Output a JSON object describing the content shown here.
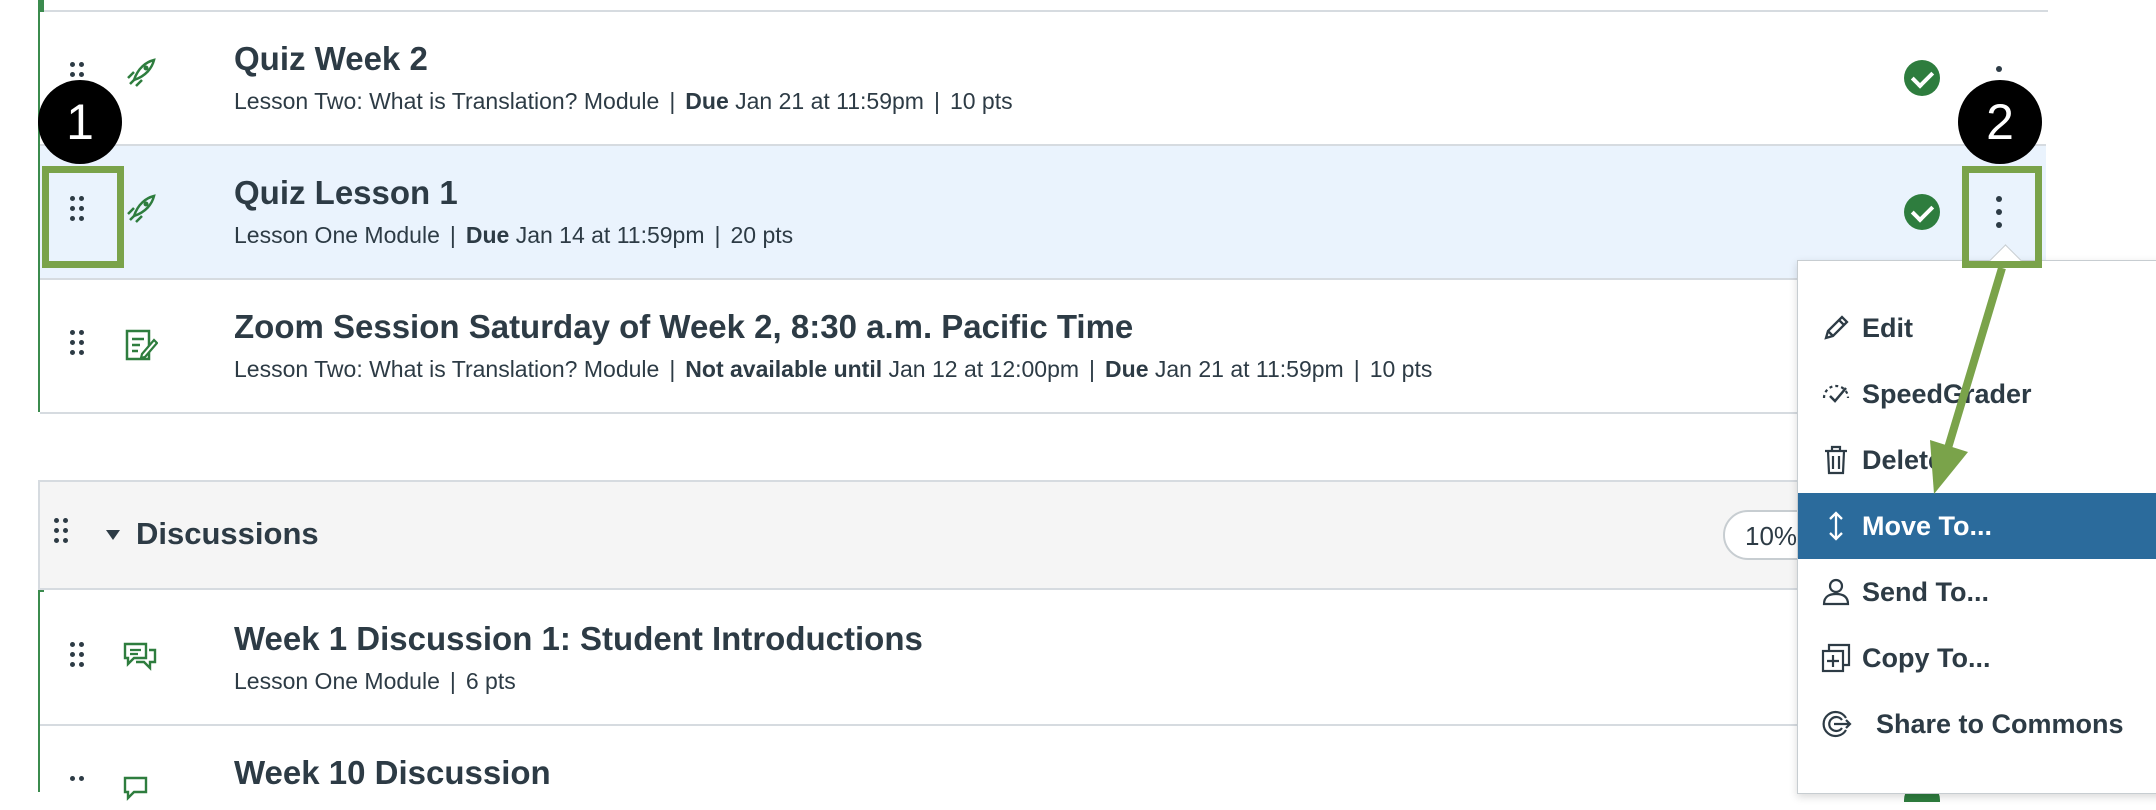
{
  "rows": [
    {
      "title": "Quiz Week 2",
      "module": "Lesson Two: What is Translation? Module",
      "due_label": "Due",
      "due": "Jan 21 at 11:59pm",
      "pts": "10 pts",
      "type": "quiz"
    },
    {
      "title": "Quiz Lesson 1",
      "module": "Lesson One Module",
      "due_label": "Due",
      "due": "Jan 14 at 11:59pm",
      "pts": "20 pts",
      "type": "quiz",
      "selected": true
    },
    {
      "title": "Zoom Session Saturday of Week 2, 8:30 a.m. Pacific Time",
      "module": "Lesson Two: What is Translation? Module",
      "avail_label": "Not available until",
      "avail": "Jan 12 at 12:00pm",
      "due_label": "Due",
      "due": "Jan 21 at 11:59pm",
      "pts": "10 pts",
      "type": "assignment"
    }
  ],
  "group": {
    "title": "Discussions",
    "weight": "10%"
  },
  "discussion_rows": [
    {
      "title": "Week 1 Discussion 1: Student Introductions",
      "module": "Lesson One Module",
      "pts": "6 pts",
      "type": "discussion"
    },
    {
      "title": "Week 10 Discussion",
      "type": "discussion"
    }
  ],
  "menu": {
    "items": [
      {
        "label": "Edit",
        "icon": "pencil-icon"
      },
      {
        "label": "SpeedGrader",
        "icon": "speedgrader-icon"
      },
      {
        "label": "Delete",
        "icon": "trash-icon"
      },
      {
        "label": "Move To...",
        "icon": "move-icon",
        "active": true
      },
      {
        "label": "Send To...",
        "icon": "user-send-icon"
      },
      {
        "label": "Copy To...",
        "icon": "copy-icon"
      },
      {
        "label": "Share to Commons",
        "icon": "commons-icon"
      }
    ]
  },
  "callouts": {
    "one": "1",
    "two": "2"
  },
  "colors": {
    "accent_green": "#3b8b4e",
    "callout_green": "#7aa34a",
    "menu_active": "#2b6b9c",
    "selected_row": "#eaf3fd"
  }
}
